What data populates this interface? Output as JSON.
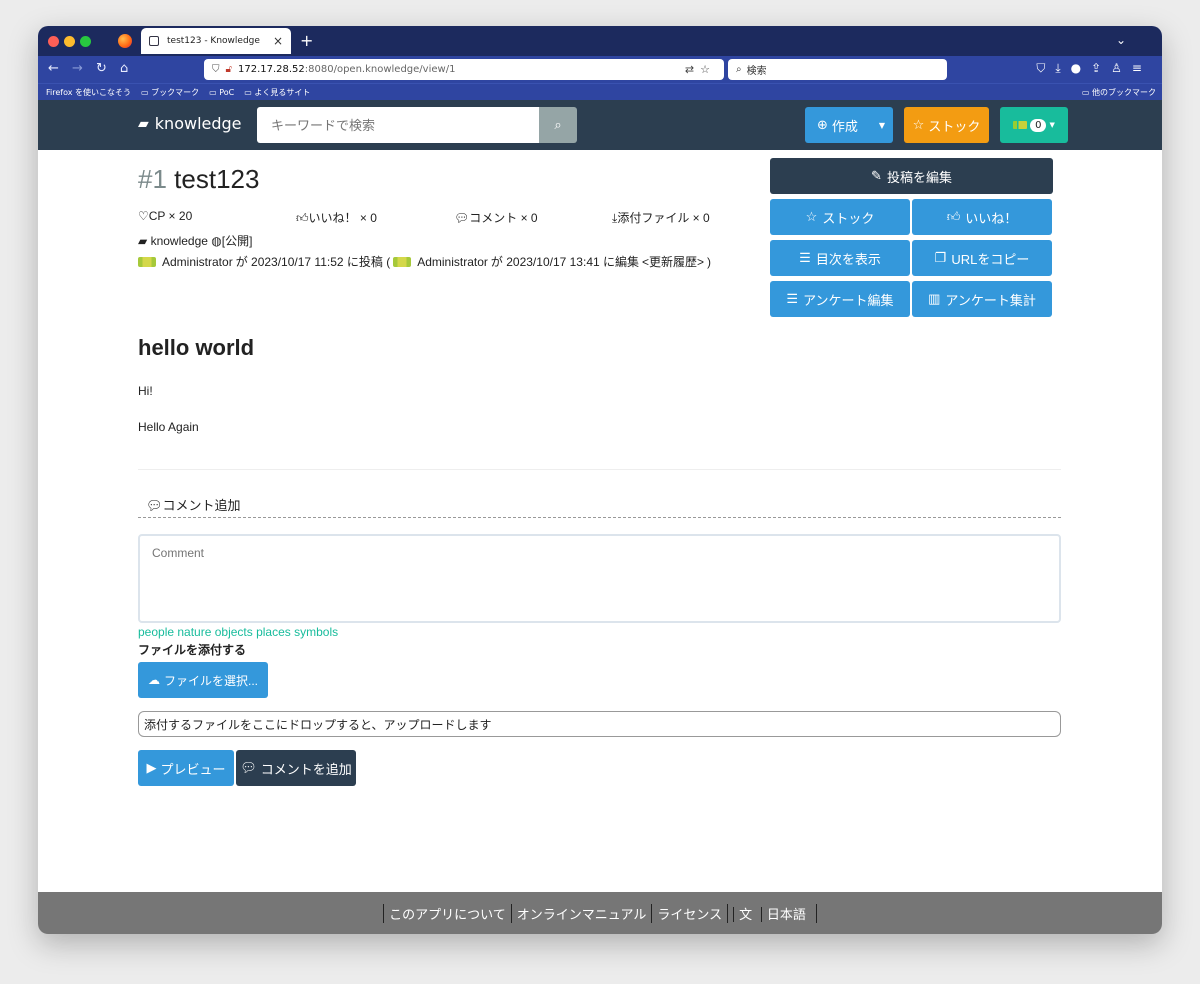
{
  "browser": {
    "tab_title": "test123 - Knowledge",
    "url_host": "172.17.28.52",
    "url_rest": ":8080/open.knowledge/view/1",
    "search_placeholder": "検索",
    "bookmarks": [
      "Firefox を使いこなそう",
      "ブックマーク",
      "PoC",
      "よく見るサイト"
    ],
    "bookmarks_other": "他のブックマーク"
  },
  "header": {
    "brand": "knowledge",
    "search_placeholder": "キーワードで検索",
    "create_label": "作成",
    "stock_label": "ストック",
    "notification_count": "0"
  },
  "article": {
    "number": "#1",
    "title": "test123",
    "cp": "CP × 20",
    "likes": "いいね！ × 0",
    "comments": "コメント × 0",
    "attachments": "添付ファイル × 0",
    "group": "knowledge",
    "visibility": "[公開]",
    "author1": "Administrator",
    "posted_text": "が 2023/10/17 11:52 に投稿 (",
    "author2": "Administrator",
    "edited_text": "が 2023/10/17 13:41 に編集",
    "history_link": "<更新履歴>",
    "close_paren": ")",
    "heading": "hello world",
    "para1": "Hi!",
    "para2": "Hello Again"
  },
  "actions": {
    "edit": "投稿を編集",
    "stock": "ストック",
    "like": "いいね！",
    "toc": "目次を表示",
    "copy_url": "URLをコピー",
    "survey_edit": "アンケート編集",
    "survey_stats": "アンケート集計"
  },
  "comment": {
    "add_title": "コメント追加",
    "placeholder": "Comment",
    "emoji_links": "people nature objects places symbols",
    "attach_label": "ファイルを添付する",
    "file_button": "ファイルを選択...",
    "dropzone": "添付するファイルをここにドロップすると、アップロードします",
    "preview": "プレビュー",
    "submit": "コメントを追加"
  },
  "footer": {
    "about": "このアプリについて",
    "manual": "オンラインマニュアル",
    "license": "ライセンス",
    "language": "日本語"
  }
}
